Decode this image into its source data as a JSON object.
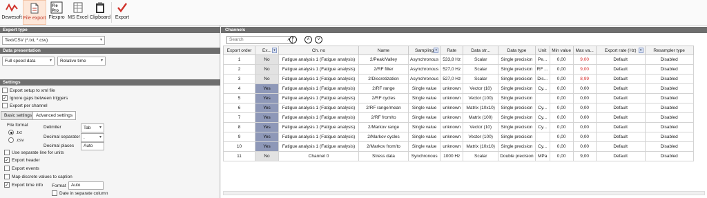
{
  "toolbar": {
    "buttons": [
      {
        "label": "Dewesoft",
        "icon": "dewesoft-logo-icon"
      },
      {
        "label": "File export",
        "icon": "file-export-icon"
      },
      {
        "label": "Flexpro",
        "icon": "flexpro-icon"
      },
      {
        "label": "MS Excel",
        "icon": "ms-excel-icon"
      },
      {
        "label": "Clipboard",
        "icon": "clipboard-icon"
      },
      {
        "label": "Export",
        "icon": "checkmark-icon"
      }
    ],
    "flexpro_logo_text": [
      "Fle",
      "Pro"
    ]
  },
  "left": {
    "export_type_header": "Export type",
    "export_type_value": "Text/CSV (*.txt, *.csv)",
    "data_presentation_header": "Data presentation",
    "data_mode": "Full speed data",
    "time_mode": "Relative time",
    "settings_header": "Settings",
    "checks": [
      {
        "label": "Export setup to xml file",
        "checked": false
      },
      {
        "label": "Ignore gaps between triggers",
        "checked": true
      },
      {
        "label": "Export per channel",
        "checked": false
      }
    ],
    "tabs": [
      "Basic settings",
      "Advanced settings"
    ],
    "file_format_label": "File format",
    "formats": [
      ".txt",
      ".csv"
    ],
    "delimiter_label": "Delimiter",
    "delimiter_value": "Tab",
    "decimal_sep_label": "Decimal separator",
    "decimal_sep_value": ".",
    "decimal_places_label": "Decimal places",
    "decimal_places_value": "Auto",
    "checks2": [
      {
        "label": "Use separate line for units",
        "checked": false
      },
      {
        "label": "Export header",
        "checked": true
      },
      {
        "label": "Export events",
        "checked": false
      },
      {
        "label": "Map discrete values to caption",
        "checked": false
      },
      {
        "label": "Export time info",
        "checked": true
      }
    ],
    "format_label": "Format",
    "format_value": "Auto",
    "date_sep_label": "Date in separate column"
  },
  "right": {
    "header": "Channels",
    "search_placeholder": "Search",
    "columns": [
      "Export order",
      "Ex...",
      "Ch. no",
      "Name",
      "Sampling",
      "Rate",
      "Data str...",
      "Data type",
      "Unit",
      "Min value",
      "Max va...",
      "Export rate (Hz)",
      "Resampler type"
    ],
    "rows": [
      {
        "order": "1",
        "ex": "No",
        "ch": "Fatigue analysis 1 (Fatigue analysis)",
        "name": "2/Peak/Valley",
        "sampling": "Asynchronous",
        "rate": "533,8 Hz",
        "ds": "Scalar",
        "dt": "Single precision",
        "unit": "Pe...",
        "min": "0,00",
        "max": "9,00",
        "maxred": true,
        "er": "Default",
        "rs": "Disabled"
      },
      {
        "order": "2",
        "ex": "No",
        "ch": "Fatigue analysis 1 (Fatigue analysis)",
        "name": "2/RF filter",
        "sampling": "Asynchronous",
        "rate": "527,0 Hz",
        "ds": "Scalar",
        "dt": "Single precision",
        "unit": "RF ...",
        "min": "0,00",
        "max": "9,00",
        "maxred": true,
        "er": "Default",
        "rs": "Disabled"
      },
      {
        "order": "3",
        "ex": "No",
        "ch": "Fatigue analysis 1 (Fatigue analysis)",
        "name": "2/Discretization",
        "sampling": "Asynchronous",
        "rate": "527,0 Hz",
        "ds": "Scalar",
        "dt": "Single precision",
        "unit": "Dis...",
        "min": "0,00",
        "max": "8,99",
        "maxred": true,
        "er": "Default",
        "rs": "Disabled"
      },
      {
        "order": "4",
        "ex": "Yes",
        "ch": "Fatigue analysis 1 (Fatigue analysis)",
        "name": "2/RF range",
        "sampling": "Single value",
        "rate": "unknown",
        "ds": "Vector (10)",
        "dt": "Single precision",
        "unit": "Cy...",
        "min": "0,00",
        "max": "0,00",
        "maxred": false,
        "er": "Default",
        "rs": "Disabled"
      },
      {
        "order": "5",
        "ex": "Yes",
        "ch": "Fatigue analysis 1 (Fatigue analysis)",
        "name": "2/RF cycles",
        "sampling": "Single value",
        "rate": "unknown",
        "ds": "Vector (100)",
        "dt": "Single precision",
        "unit": "",
        "min": "0,00",
        "max": "0,00",
        "maxred": false,
        "er": "Default",
        "rs": "Disabled"
      },
      {
        "order": "6",
        "ex": "Yes",
        "ch": "Fatigue analysis 1 (Fatigue analysis)",
        "name": "2/RF range/mean",
        "sampling": "Single value",
        "rate": "unknown",
        "ds": "Matrix (10x10)",
        "dt": "Single precision",
        "unit": "Cy...",
        "min": "0,00",
        "max": "0,00",
        "maxred": false,
        "er": "Default",
        "rs": "Disabled"
      },
      {
        "order": "7",
        "ex": "Yes",
        "ch": "Fatigue analysis 1 (Fatigue analysis)",
        "name": "2/RF from/to",
        "sampling": "Single value",
        "rate": "unknown",
        "ds": "Matrix (100)",
        "dt": "Single precision",
        "unit": "Cy...",
        "min": "0,00",
        "max": "0,00",
        "maxred": false,
        "er": "Default",
        "rs": "Disabled"
      },
      {
        "order": "8",
        "ex": "Yes",
        "ch": "Fatigue analysis 1 (Fatigue analysis)",
        "name": "2/Markov range",
        "sampling": "Single value",
        "rate": "unknown",
        "ds": "Vector (10)",
        "dt": "Single precision",
        "unit": "Cy...",
        "min": "0,00",
        "max": "0,00",
        "maxred": false,
        "er": "Default",
        "rs": "Disabled"
      },
      {
        "order": "9",
        "ex": "Yes",
        "ch": "Fatigue analysis 1 (Fatigue analysis)",
        "name": "2/Markov cycles",
        "sampling": "Single value",
        "rate": "unknown",
        "ds": "Vector (100)",
        "dt": "Single precision",
        "unit": "",
        "min": "0,00",
        "max": "0,00",
        "maxred": false,
        "er": "Default",
        "rs": "Disabled"
      },
      {
        "order": "10",
        "ex": "Yes",
        "ch": "Fatigue analysis 1 (Fatigue analysis)",
        "name": "2/Markov from/to",
        "sampling": "Single value",
        "rate": "unknown",
        "ds": "Matrix (10x10)",
        "dt": "Single precision",
        "unit": "Cy...",
        "min": "0,00",
        "max": "0,00",
        "maxred": false,
        "er": "Default",
        "rs": "Disabled"
      },
      {
        "order": "11",
        "ex": "No",
        "ch": "Channel 0",
        "name": "Stress data",
        "sampling": "Synchronous",
        "rate": "1000 Hz",
        "ds": "Scalar",
        "dt": "Double precision",
        "unit": "MPa",
        "min": "0,00",
        "max": "9,00",
        "maxred": false,
        "er": "Default",
        "rs": "Disabled"
      }
    ]
  },
  "colors": {
    "accent": "#c0392b",
    "yes_bg": "#8e98b8",
    "max_red": "#d62b2b"
  }
}
